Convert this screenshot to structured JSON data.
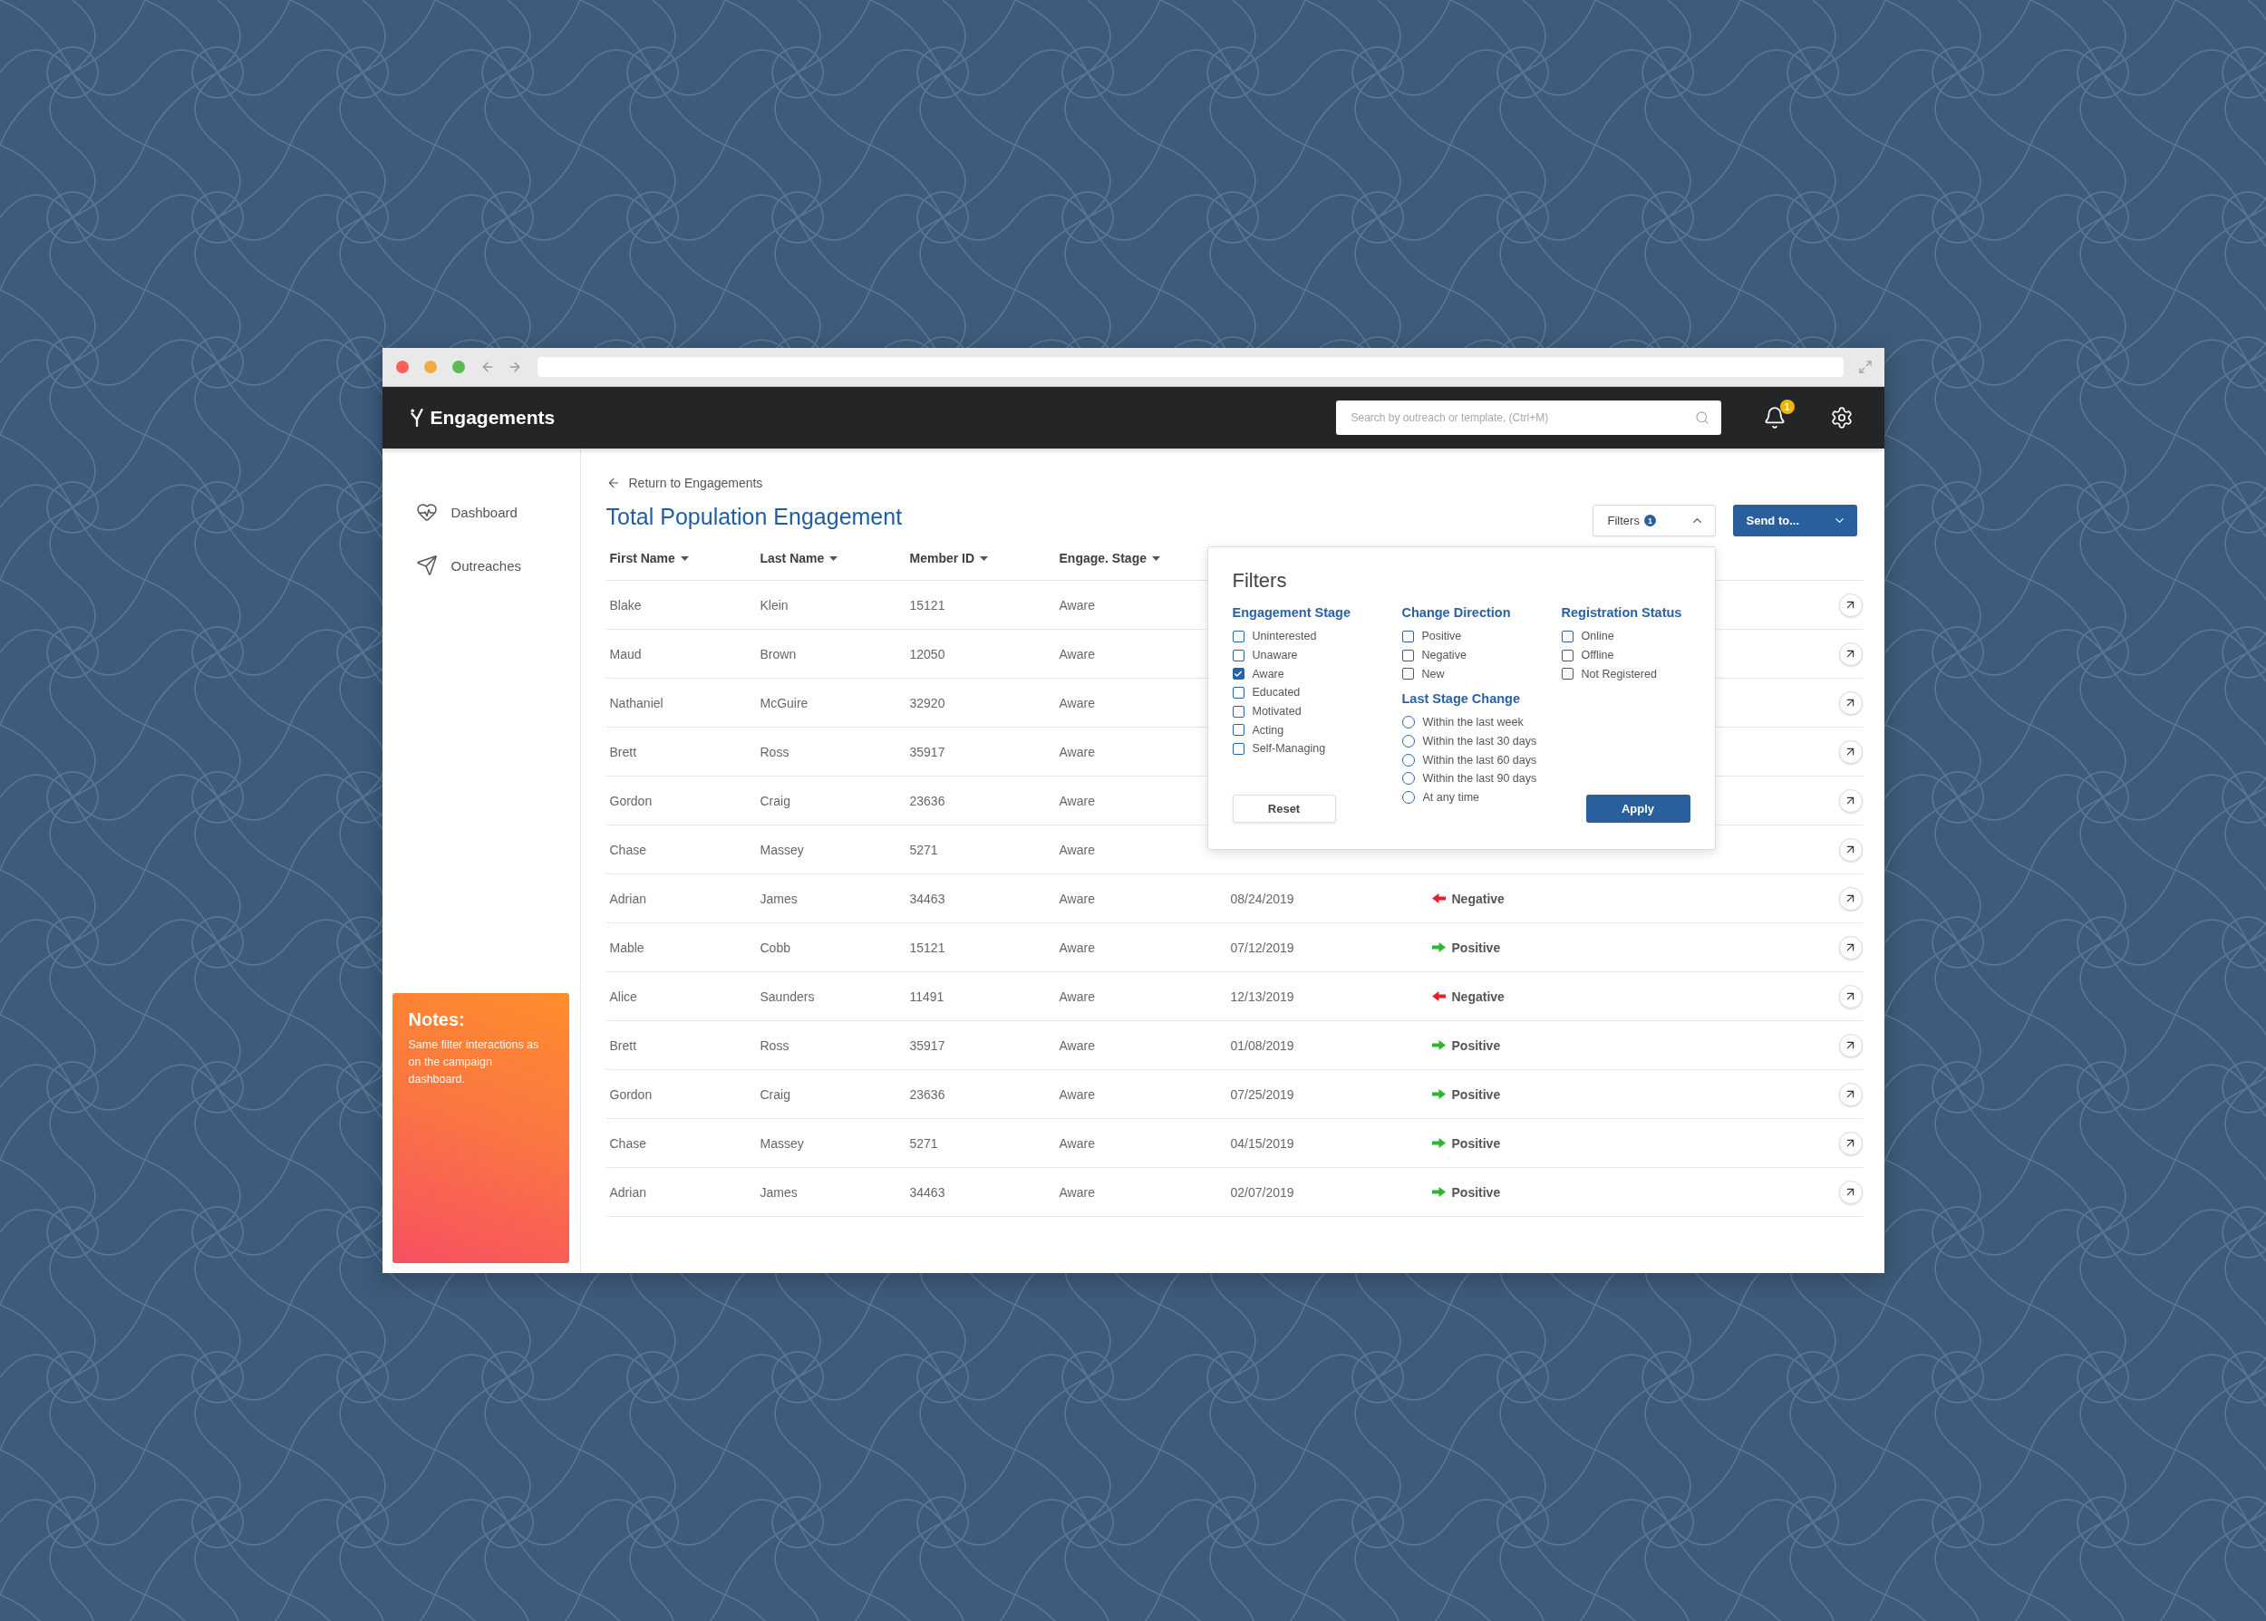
{
  "header": {
    "app_name": "Engagements",
    "search": {
      "placeholder": "Search by outreach or template, (Ctrl+M)"
    },
    "notifications": {
      "count": "1"
    }
  },
  "sidebar": {
    "items": [
      {
        "label": "Dashboard",
        "selected": false
      },
      {
        "label": "Outreaches",
        "selected": false
      }
    ],
    "notes": {
      "title": "Notes:",
      "text": "Same filter interactions as on the campaign dashboard."
    }
  },
  "page": {
    "back_link": "Return to Engagements",
    "title": "Total Population Engagement",
    "filters_button": {
      "label": "Filters",
      "count": "1",
      "expanded": true
    },
    "send_button": {
      "label": "Send to..."
    }
  },
  "table": {
    "columns": [
      "First Name",
      "Last Name",
      "Member ID",
      "Engage. Stage"
    ],
    "rows": [
      {
        "first_name": "Blake",
        "last_name": "Klein",
        "member_id": "15121",
        "engage_stage": "Aware"
      },
      {
        "first_name": "Maud",
        "last_name": "Brown",
        "member_id": "12050",
        "engage_stage": "Aware"
      },
      {
        "first_name": "Nathaniel",
        "last_name": "McGuire",
        "member_id": "32920",
        "engage_stage": "Aware"
      },
      {
        "first_name": "Brett",
        "last_name": "Ross",
        "member_id": "35917",
        "engage_stage": "Aware"
      },
      {
        "first_name": "Gordon",
        "last_name": "Craig",
        "member_id": "23636",
        "engage_stage": "Aware"
      },
      {
        "first_name": "Chase",
        "last_name": "Massey",
        "member_id": "5271",
        "engage_stage": "Aware"
      },
      {
        "first_name": "Adrian",
        "last_name": "James",
        "member_id": "34463",
        "engage_stage": "Aware",
        "column_5": "08/24/2019",
        "column_6": {
          "kind": "negative",
          "label": "Negative"
        }
      },
      {
        "first_name": "Mable",
        "last_name": "Cobb",
        "member_id": "15121",
        "engage_stage": "Aware",
        "column_5": "07/12/2019",
        "column_6": {
          "kind": "positive",
          "label": "Positive"
        }
      },
      {
        "first_name": "Alice",
        "last_name": "Saunders",
        "member_id": "11491",
        "engage_stage": "Aware",
        "column_5": "12/13/2019",
        "column_6": {
          "kind": "negative",
          "label": "Negative"
        }
      },
      {
        "first_name": "Brett",
        "last_name": "Ross",
        "member_id": "35917",
        "engage_stage": "Aware",
        "column_5": "01/08/2019",
        "column_6": {
          "kind": "positive",
          "label": "Positive"
        }
      },
      {
        "first_name": "Gordon",
        "last_name": "Craig",
        "member_id": "23636",
        "engage_stage": "Aware",
        "column_5": "07/25/2019",
        "column_6": {
          "kind": "positive",
          "label": "Positive"
        }
      },
      {
        "first_name": "Chase",
        "last_name": "Massey",
        "member_id": "5271",
        "engage_stage": "Aware",
        "column_5": "04/15/2019",
        "column_6": {
          "kind": "positive",
          "label": "Positive"
        }
      },
      {
        "first_name": "Adrian",
        "last_name": "James",
        "member_id": "34463",
        "engage_stage": "Aware",
        "column_5": "02/07/2019",
        "column_6": {
          "kind": "positive",
          "label": "Positive"
        }
      }
    ]
  },
  "filters_panel": {
    "title": "Filters",
    "columns": [
      [
        {
          "heading": "Engagement Stage",
          "kind": "checkbox",
          "options": [
            {
              "label": "Uninterested",
              "checked": false
            },
            {
              "label": "Unaware",
              "checked": false
            },
            {
              "label": "Aware",
              "checked": true
            },
            {
              "label": "Educated",
              "checked": false
            },
            {
              "label": "Motivated",
              "checked": false
            },
            {
              "label": "Acting",
              "checked": false
            },
            {
              "label": "Self-Managing",
              "checked": false
            }
          ]
        }
      ],
      [
        {
          "heading": "Change Direction",
          "kind": "checkbox",
          "options": [
            {
              "label": "Positive",
              "checked": false
            },
            {
              "label": "Negative",
              "checked": false
            },
            {
              "label": "New",
              "checked": false
            }
          ]
        },
        {
          "heading": "Last Stage Change",
          "kind": "radio",
          "options": [
            {
              "label": "Within the last week",
              "selected": false
            },
            {
              "label": "Within the last 30 days",
              "selected": false
            },
            {
              "label": "Within the last 60 days",
              "selected": false
            },
            {
              "label": "Within the last 90 days",
              "selected": false
            },
            {
              "label": "At any time",
              "selected": false
            }
          ]
        }
      ],
      [
        {
          "heading": "Registration Status",
          "kind": "checkbox",
          "options": [
            {
              "label": "Online",
              "checked": false
            },
            {
              "label": "Offline",
              "checked": false
            },
            {
              "label": "Not Registered",
              "checked": false
            }
          ]
        }
      ]
    ],
    "reset_button": "Reset",
    "apply_button": "Apply"
  }
}
